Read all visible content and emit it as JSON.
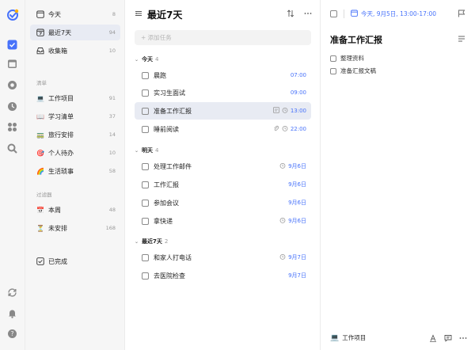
{
  "sidebar": {
    "smart": [
      {
        "label": "今天",
        "count": "8",
        "icon": "today-icon"
      },
      {
        "label": "最近7天",
        "count": "94",
        "icon": "next7-icon"
      },
      {
        "label": "收集箱",
        "count": "10",
        "icon": "inbox-icon"
      }
    ],
    "lists_header": "清单",
    "lists": [
      {
        "label": "工作项目",
        "count": "91",
        "emoji": "💻"
      },
      {
        "label": "学习清单",
        "count": "37",
        "emoji": "📖"
      },
      {
        "label": "旅行安排",
        "count": "14",
        "emoji": "🚃"
      },
      {
        "label": "个人待办",
        "count": "10",
        "emoji": "🎯"
      },
      {
        "label": "生活琐事",
        "count": "58",
        "emoji": "🌈"
      }
    ],
    "filters_header": "过滤器",
    "filters": [
      {
        "label": "本周",
        "count": "48",
        "emoji": "📅"
      },
      {
        "label": "未安排",
        "count": "168",
        "emoji": "⏳"
      }
    ],
    "completed": {
      "label": "已完成",
      "icon": "completed-icon"
    }
  },
  "middle": {
    "title": "最近7天",
    "add_placeholder": "+ 添加任务",
    "groups": [
      {
        "name": "今天",
        "count": "4",
        "tasks": [
          {
            "label": "晨跑",
            "meta": "07:00",
            "color": "#4772fa",
            "icons": []
          },
          {
            "label": "实习生面试",
            "meta": "09:00",
            "color": "#4772fa",
            "icons": []
          },
          {
            "label": "准备工作汇报",
            "meta": "13:00",
            "color": "#4772fa",
            "icons": [
              "subtask-icon",
              "alarm-icon"
            ],
            "selected": true
          },
          {
            "label": "睡前阅读",
            "meta": "22:00",
            "color": "#4772fa",
            "icons": [
              "attachment-icon",
              "alarm-icon"
            ]
          }
        ]
      },
      {
        "name": "明天",
        "count": "4",
        "tasks": [
          {
            "label": "处理工作邮件",
            "meta": "9月6日",
            "color": "#4772fa",
            "icons": [
              "alarm-icon"
            ]
          },
          {
            "label": "工作汇报",
            "meta": "9月6日",
            "color": "#4772fa",
            "icons": []
          },
          {
            "label": "参加会议",
            "meta": "9月6日",
            "color": "#4772fa",
            "icons": []
          },
          {
            "label": "拿快递",
            "meta": "9月6日",
            "color": "#4772fa",
            "icons": [
              "alarm-icon"
            ]
          }
        ]
      },
      {
        "name": "最近7天",
        "count": "2",
        "tasks": [
          {
            "label": "和家人打电话",
            "meta": "9月7日",
            "color": "#4772fa",
            "icons": [
              "alarm-icon"
            ]
          },
          {
            "label": "去医院检查",
            "meta": "9月7日",
            "color": "#4772fa",
            "icons": []
          }
        ]
      }
    ]
  },
  "detail": {
    "date": "今天, 9月5日, 13:00-17:00",
    "title": "准备工作汇报",
    "subtasks": [
      "整理资料",
      "准备汇报文稿"
    ],
    "list_name": "工作项目",
    "list_emoji": "💻"
  },
  "colors": {
    "accent": "#4772fa",
    "selected_bg": "#e8ebf3"
  }
}
